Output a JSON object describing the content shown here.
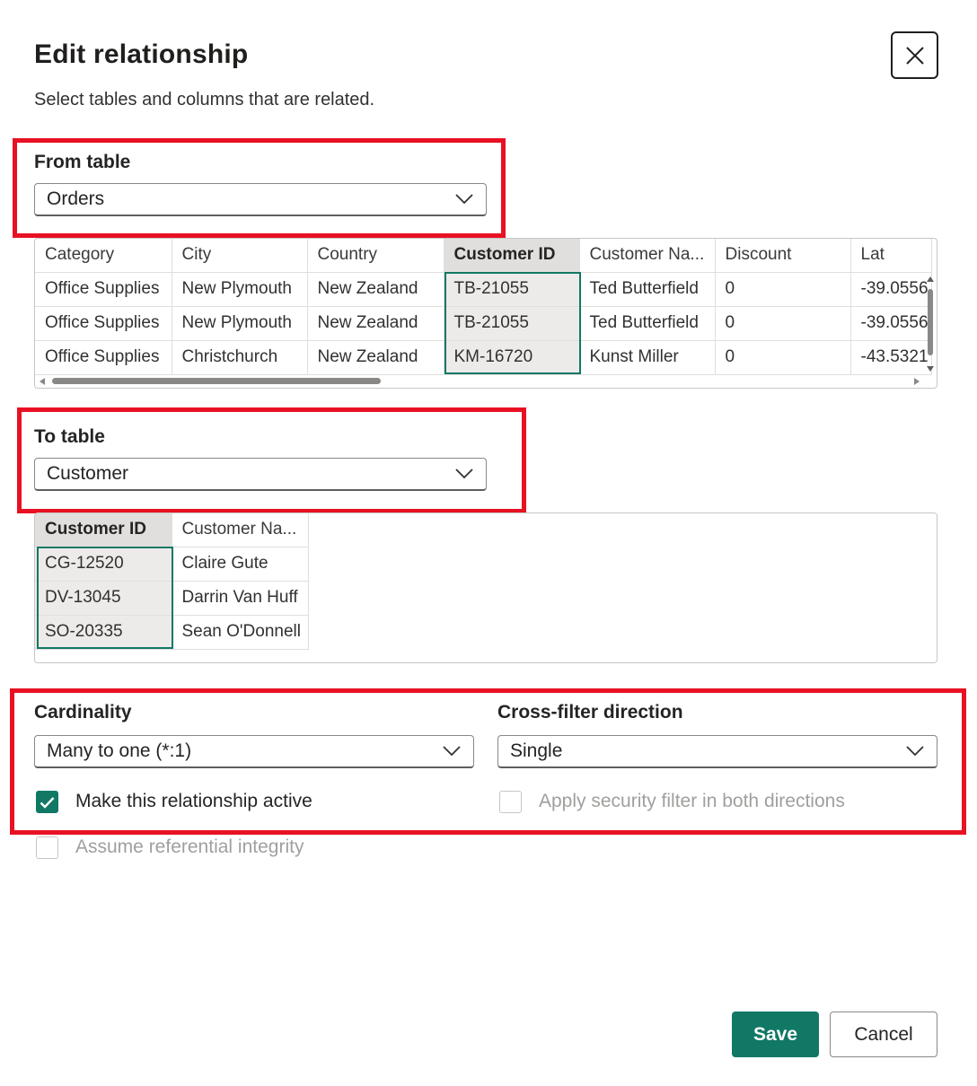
{
  "dialog": {
    "title": "Edit relationship",
    "subtitle": "Select tables and columns that are related."
  },
  "from": {
    "label": "From table",
    "selected": "Orders",
    "columns": [
      "Category",
      "City",
      "Country",
      "Customer ID",
      "Customer Na...",
      "Discount",
      "Lat"
    ],
    "rows": [
      [
        "Office Supplies",
        "New Plymouth",
        "New Zealand",
        "TB-21055",
        "Ted Butterfield",
        "0",
        "-39.0556"
      ],
      [
        "Office Supplies",
        "New Plymouth",
        "New Zealand",
        "TB-21055",
        "Ted Butterfield",
        "0",
        "-39.0556"
      ],
      [
        "Office Supplies",
        "Christchurch",
        "New Zealand",
        "KM-16720",
        "Kunst Miller",
        "0",
        "-43.5321"
      ]
    ],
    "selected_column": "Customer ID"
  },
  "to": {
    "label": "To table",
    "selected": "Customer",
    "columns": [
      "Customer ID",
      "Customer Na..."
    ],
    "rows": [
      [
        "CG-12520",
        "Claire Gute"
      ],
      [
        "DV-13045",
        "Darrin Van Huff"
      ],
      [
        "SO-20335",
        "Sean O'Donnell"
      ]
    ],
    "selected_column": "Customer ID"
  },
  "cardinality": {
    "label": "Cardinality",
    "selected": "Many to one (*:1)"
  },
  "crossfilter": {
    "label": "Cross-filter direction",
    "selected": "Single"
  },
  "options": {
    "active_label": "Make this relationship active",
    "active_checked": true,
    "security_label": "Apply security filter in both directions",
    "security_checked": false,
    "referential_label": "Assume referential integrity",
    "referential_checked": false
  },
  "buttons": {
    "save": "Save",
    "cancel": "Cancel"
  },
  "colors": {
    "accent": "#117865",
    "highlight": "#e81123"
  },
  "icons": {
    "close": "close-icon",
    "dropdown": "chevron-down-icon",
    "check": "checkmark-icon"
  }
}
